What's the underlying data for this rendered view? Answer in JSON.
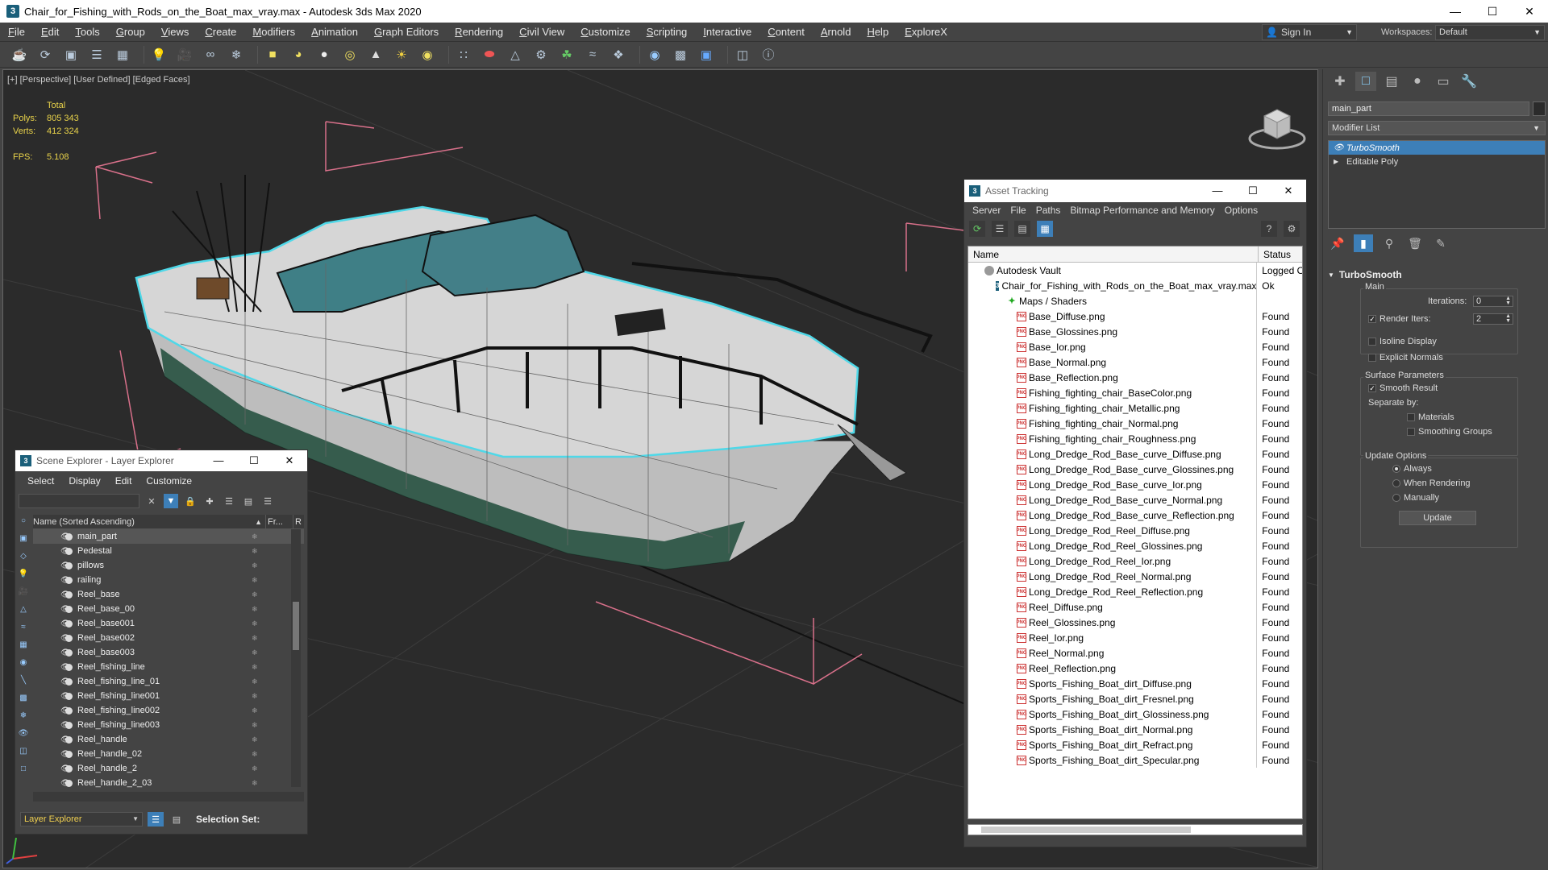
{
  "window": {
    "title": "Chair_for_Fishing_with_Rods_on_the_Boat_max_vray.max - Autodesk 3ds Max 2020",
    "app_icon": "3"
  },
  "menu": [
    "File",
    "Edit",
    "Tools",
    "Group",
    "Views",
    "Create",
    "Modifiers",
    "Animation",
    "Graph Editors",
    "Rendering",
    "Civil View",
    "Customize",
    "Scripting",
    "Interactive",
    "Content",
    "Arnold",
    "Help",
    "ExploreX"
  ],
  "signin": {
    "label": "Sign In"
  },
  "workspace": {
    "label": "Workspaces:",
    "value": "Default"
  },
  "viewport": {
    "label": "[+] [Perspective] [User Defined] [Edged Faces]",
    "stats": {
      "total_label": "Total",
      "polys_label": "Polys:",
      "polys": "805 343",
      "verts_label": "Verts:",
      "verts": "412 324",
      "fps_label": "FPS:",
      "fps": "5.108"
    }
  },
  "command_panel": {
    "object_name": "main_part",
    "modifier_list": "Modifier List",
    "stack": [
      {
        "label": "TurboSmooth",
        "selected": true
      },
      {
        "label": "Editable Poly",
        "selected": false
      }
    ],
    "rollout": {
      "title": "TurboSmooth",
      "main_label": "Main",
      "iterations_label": "Iterations:",
      "iterations": "0",
      "render_iters_label": "Render Iters:",
      "render_iters": "2",
      "isoline": "Isoline Display",
      "explicit_normals": "Explicit Normals",
      "surface_label": "Surface Parameters",
      "smooth_result": "Smooth Result",
      "separate_by": "Separate by:",
      "materials": "Materials",
      "smoothing_groups": "Smoothing Groups",
      "update_options": "Update Options",
      "always": "Always",
      "when_rendering": "When Rendering",
      "manually": "Manually",
      "update_button": "Update"
    }
  },
  "asset_tracking": {
    "title": "Asset Tracking",
    "menu": [
      "Server",
      "File",
      "Paths",
      "Bitmap Performance and Memory",
      "Options"
    ],
    "col_name": "Name",
    "col_status": "Status",
    "rows": [
      {
        "name": "Autodesk Vault",
        "status": "Logged O",
        "icon": "vault"
      },
      {
        "name": "Chair_for_Fishing_with_Rods_on_the_Boat_max_vray.max",
        "status": "Ok",
        "icon": "max"
      },
      {
        "name": "Maps / Shaders",
        "status": "",
        "icon": "maps"
      },
      {
        "name": "Base_Diffuse.png",
        "status": "Found",
        "icon": "png"
      },
      {
        "name": "Base_Glossines.png",
        "status": "Found",
        "icon": "png"
      },
      {
        "name": "Base_Ior.png",
        "status": "Found",
        "icon": "png"
      },
      {
        "name": "Base_Normal.png",
        "status": "Found",
        "icon": "png"
      },
      {
        "name": "Base_Reflection.png",
        "status": "Found",
        "icon": "png"
      },
      {
        "name": "Fishing_fighting_chair_BaseColor.png",
        "status": "Found",
        "icon": "png"
      },
      {
        "name": "Fishing_fighting_chair_Metallic.png",
        "status": "Found",
        "icon": "png"
      },
      {
        "name": "Fishing_fighting_chair_Normal.png",
        "status": "Found",
        "icon": "png"
      },
      {
        "name": "Fishing_fighting_chair_Roughness.png",
        "status": "Found",
        "icon": "png"
      },
      {
        "name": "Long_Dredge_Rod_Base_curve_Diffuse.png",
        "status": "Found",
        "icon": "png"
      },
      {
        "name": "Long_Dredge_Rod_Base_curve_Glossines.png",
        "status": "Found",
        "icon": "png"
      },
      {
        "name": "Long_Dredge_Rod_Base_curve_Ior.png",
        "status": "Found",
        "icon": "png"
      },
      {
        "name": "Long_Dredge_Rod_Base_curve_Normal.png",
        "status": "Found",
        "icon": "png"
      },
      {
        "name": "Long_Dredge_Rod_Base_curve_Reflection.png",
        "status": "Found",
        "icon": "png"
      },
      {
        "name": "Long_Dredge_Rod_Reel_Diffuse.png",
        "status": "Found",
        "icon": "png"
      },
      {
        "name": "Long_Dredge_Rod_Reel_Glossines.png",
        "status": "Found",
        "icon": "png"
      },
      {
        "name": "Long_Dredge_Rod_Reel_Ior.png",
        "status": "Found",
        "icon": "png"
      },
      {
        "name": "Long_Dredge_Rod_Reel_Normal.png",
        "status": "Found",
        "icon": "png"
      },
      {
        "name": "Long_Dredge_Rod_Reel_Reflection.png",
        "status": "Found",
        "icon": "png"
      },
      {
        "name": "Reel_Diffuse.png",
        "status": "Found",
        "icon": "png"
      },
      {
        "name": "Reel_Glossines.png",
        "status": "Found",
        "icon": "png"
      },
      {
        "name": "Reel_Ior.png",
        "status": "Found",
        "icon": "png"
      },
      {
        "name": "Reel_Normal.png",
        "status": "Found",
        "icon": "png"
      },
      {
        "name": "Reel_Reflection.png",
        "status": "Found",
        "icon": "png"
      },
      {
        "name": "Sports_Fishing_Boat_dirt_Diffuse.png",
        "status": "Found",
        "icon": "png"
      },
      {
        "name": "Sports_Fishing_Boat_dirt_Fresnel.png",
        "status": "Found",
        "icon": "png"
      },
      {
        "name": "Sports_Fishing_Boat_dirt_Glossiness.png",
        "status": "Found",
        "icon": "png"
      },
      {
        "name": "Sports_Fishing_Boat_dirt_Normal.png",
        "status": "Found",
        "icon": "png"
      },
      {
        "name": "Sports_Fishing_Boat_dirt_Refract.png",
        "status": "Found",
        "icon": "png"
      },
      {
        "name": "Sports_Fishing_Boat_dirt_Specular.png",
        "status": "Found",
        "icon": "png"
      }
    ]
  },
  "scene_explorer": {
    "title": "Scene Explorer - Layer Explorer",
    "menu": [
      "Select",
      "Display",
      "Edit",
      "Customize"
    ],
    "col_name": "Name (Sorted Ascending)",
    "col_fr": "Fr...",
    "col_r": "R",
    "rows": [
      {
        "name": "main_part",
        "selected": true
      },
      {
        "name": "Pedestal"
      },
      {
        "name": "pillows"
      },
      {
        "name": "railing"
      },
      {
        "name": "Reel_base"
      },
      {
        "name": "Reel_base_00"
      },
      {
        "name": "Reel_base001"
      },
      {
        "name": "Reel_base002"
      },
      {
        "name": "Reel_base003"
      },
      {
        "name": "Reel_fishing_line"
      },
      {
        "name": "Reel_fishing_line_01"
      },
      {
        "name": "Reel_fishing_line001"
      },
      {
        "name": "Reel_fishing_line002"
      },
      {
        "name": "Reel_fishing_line003"
      },
      {
        "name": "Reel_handle"
      },
      {
        "name": "Reel_handle_02"
      },
      {
        "name": "Reel_handle_2"
      },
      {
        "name": "Reel_handle_2_03"
      }
    ],
    "layer_explorer": "Layer Explorer",
    "selection_set": "Selection Set:"
  },
  "colors": {
    "accent": "#3d7fb8",
    "selection_outline": "#4fd8e8",
    "stats": "#e8d24a",
    "bounding_box": "#d8708a"
  }
}
